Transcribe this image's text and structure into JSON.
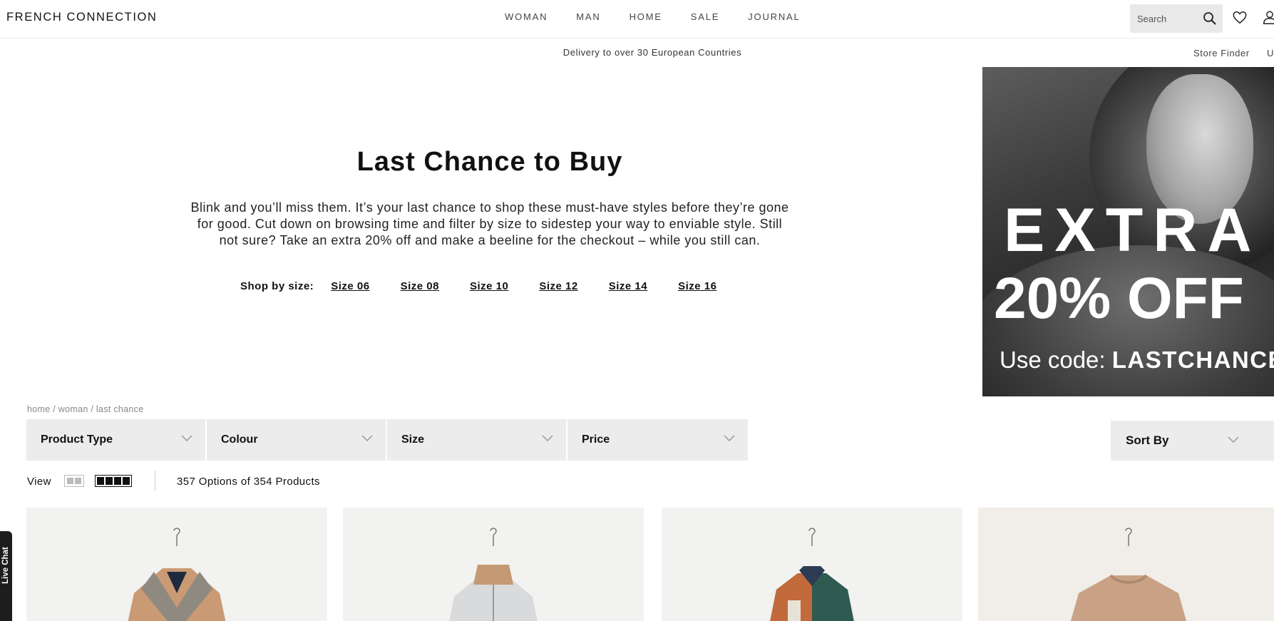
{
  "header": {
    "logo": "FRENCH CONNECTION",
    "nav": [
      "WOMAN",
      "MAN",
      "HOME",
      "SALE",
      "JOURNAL"
    ],
    "search_placeholder": "Search"
  },
  "utility": {
    "delivery": "Delivery to over 30 European Countries",
    "store_finder": "Store Finder",
    "truncated": "U"
  },
  "hero": {
    "title": "Last Chance to Buy",
    "description": "Blink and you’ll miss them. It’s your last chance to shop these must-have styles before they’re gone for good. Cut down on browsing time and filter by size to sidestep your way to enviable style. Still not sure? Take an extra 20% off and make a beeline for the checkout – while you still can.",
    "shop_by_size_label": "Shop by size:",
    "sizes": [
      "Size 06",
      "Size 08",
      "Size 10",
      "Size 12",
      "Size 14",
      "Size 16"
    ]
  },
  "promo": {
    "line1": "EXTRA",
    "line2": "20% OFF",
    "code_prefix": "Use code: ",
    "code": "LASTCHANCE"
  },
  "breadcrumb": [
    "home",
    "woman",
    "last chance"
  ],
  "filters": [
    "Product Type",
    "Colour",
    "Size",
    "Price"
  ],
  "sort_by": "Sort By",
  "view": {
    "label": "View",
    "count": "357 Options of 354 Products"
  },
  "products": [
    {
      "name": "check-coat",
      "color": "#c99a73"
    },
    {
      "name": "grey-bomber-jacket",
      "color": "#d8dadc"
    },
    {
      "name": "print-shirt-dress",
      "color": "#2f5a52"
    },
    {
      "name": "knit-jumper",
      "color": "#c9a285"
    }
  ],
  "live_chat": "Live Chat"
}
